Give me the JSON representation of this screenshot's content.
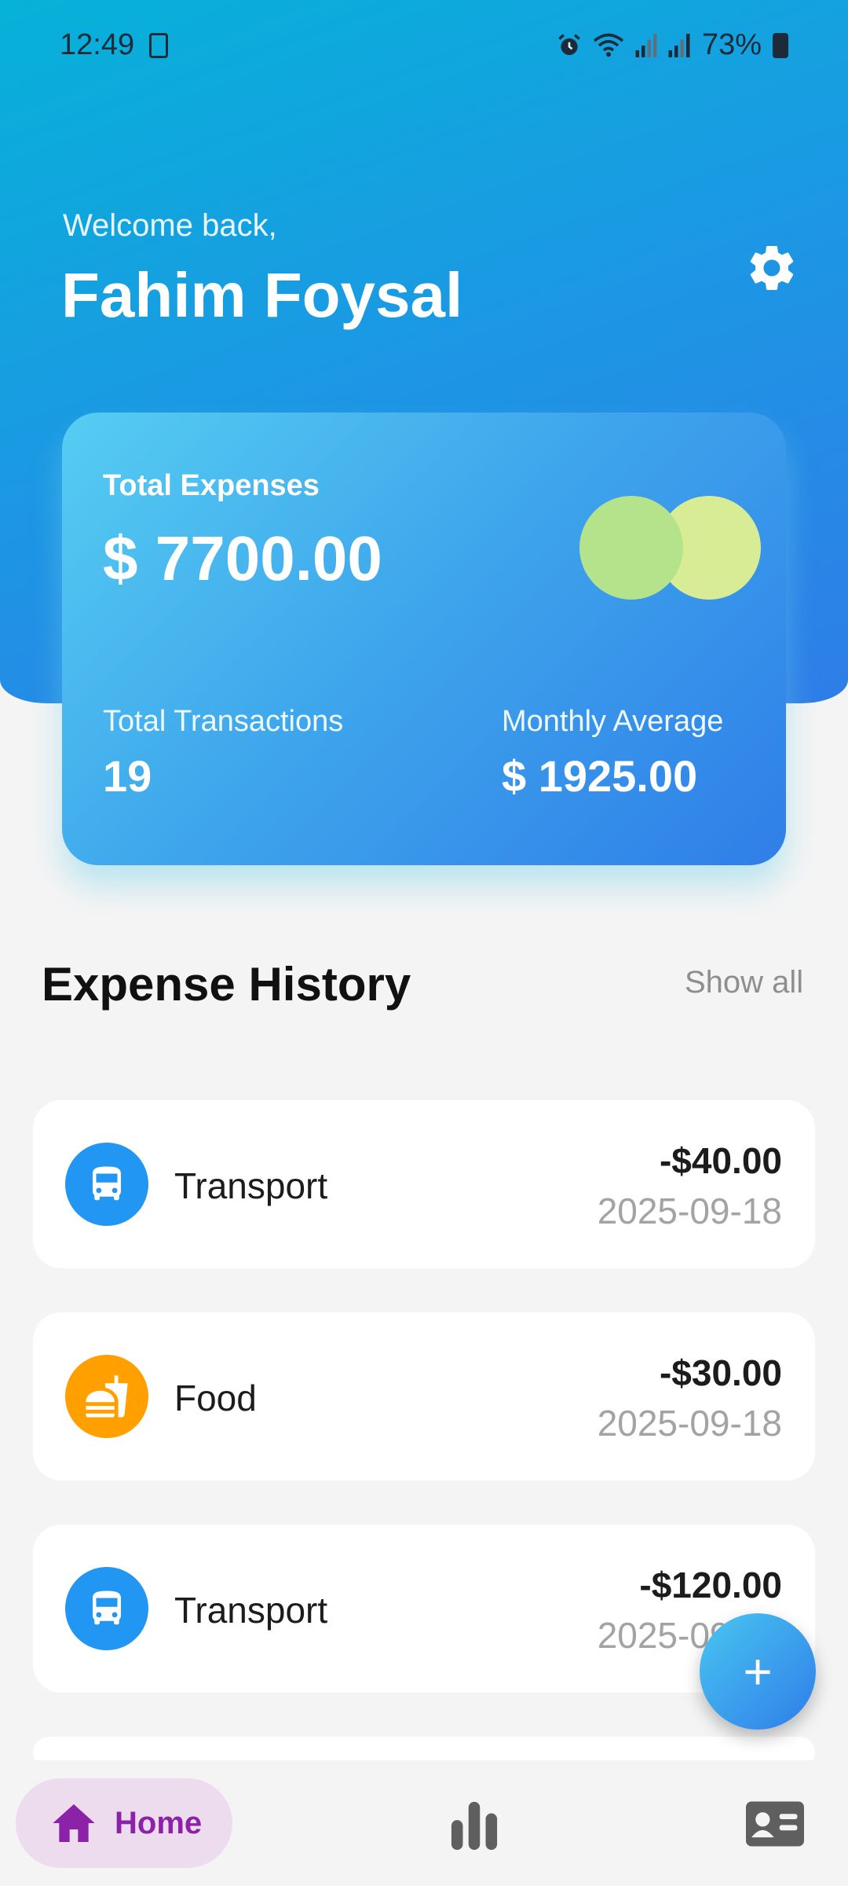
{
  "status_bar": {
    "time": "12:49",
    "battery": "73%"
  },
  "header": {
    "greeting": "Welcome back,",
    "user_name": "Fahim Foysal"
  },
  "summary": {
    "total_expenses_label": "Total Expenses",
    "total_expenses_value": "$ 7700.00",
    "total_transactions_label": "Total Transactions",
    "total_transactions_value": "19",
    "monthly_average_label": "Monthly Average",
    "monthly_average_value": "$ 1925.00"
  },
  "history": {
    "title": "Expense History",
    "show_all": "Show all",
    "items": [
      {
        "category": "Transport",
        "amount": "-$40.00",
        "date": "2025-09-18",
        "icon": "bus-icon",
        "color": "#2196f3"
      },
      {
        "category": "Food",
        "amount": "-$30.00",
        "date": "2025-09-18",
        "icon": "fastfood-icon",
        "color": "#ffa000"
      },
      {
        "category": "Transport",
        "amount": "-$120.00",
        "date": "2025-09-18",
        "icon": "bus-icon",
        "color": "#2196f3"
      }
    ]
  },
  "fab": {
    "label": "+"
  },
  "nav": {
    "home_label": "Home",
    "accent": "#8b22a8"
  }
}
